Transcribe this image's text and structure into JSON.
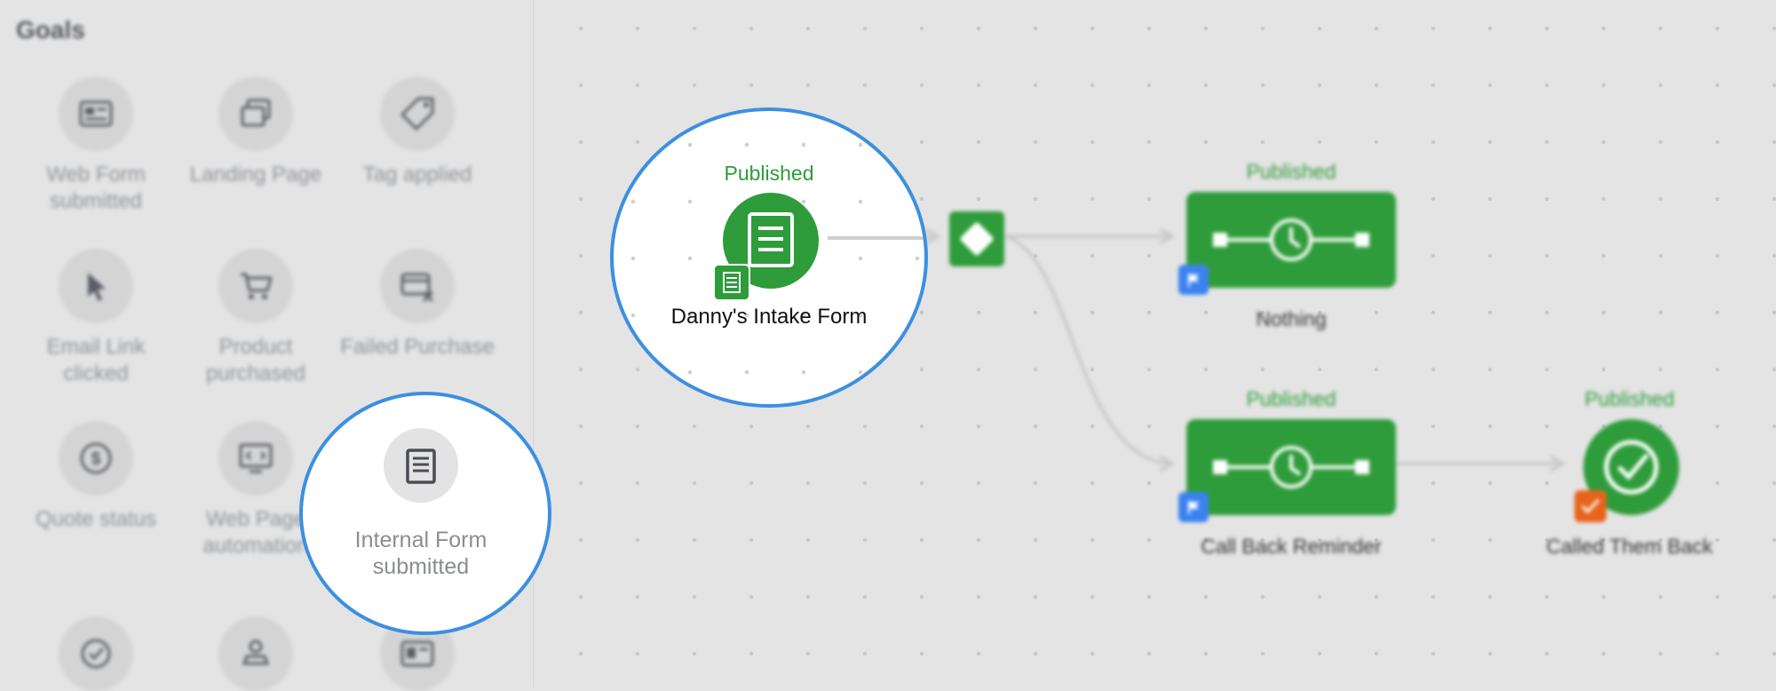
{
  "sidebar": {
    "title": "Goals",
    "goals": [
      {
        "label": "Web Form submitted",
        "icon": "web-form-icon"
      },
      {
        "label": "Landing Page",
        "icon": "landing-page-icon"
      },
      {
        "label": "Tag applied",
        "icon": "tag-icon"
      },
      {
        "label": "Email Link clicked",
        "icon": "cursor-icon"
      },
      {
        "label": "Product purchased",
        "icon": "cart-icon"
      },
      {
        "label": "Failed Purchase",
        "icon": "failed-card-icon"
      },
      {
        "label": "Quote status",
        "icon": "dollar-icon"
      },
      {
        "label": "Web Page automation",
        "icon": "code-monitor-icon"
      },
      {
        "label": "Internal Form submitted",
        "icon": "internal-form-icon"
      }
    ]
  },
  "canvas": {
    "intake_node": {
      "status": "Published",
      "label": "Danny's Intake Form"
    },
    "nothing_node": {
      "status": "Published",
      "label": "Nothing"
    },
    "callback_node": {
      "status": "Published",
      "label": "Call Back Reminder"
    },
    "called_node": {
      "status": "Published",
      "label": "Called Them Back"
    }
  },
  "colors": {
    "green": "#2e9c3a",
    "blue_flag": "#3b82f0",
    "orange_check": "#e8641c",
    "magnifier_border": "#3d8fe0"
  }
}
